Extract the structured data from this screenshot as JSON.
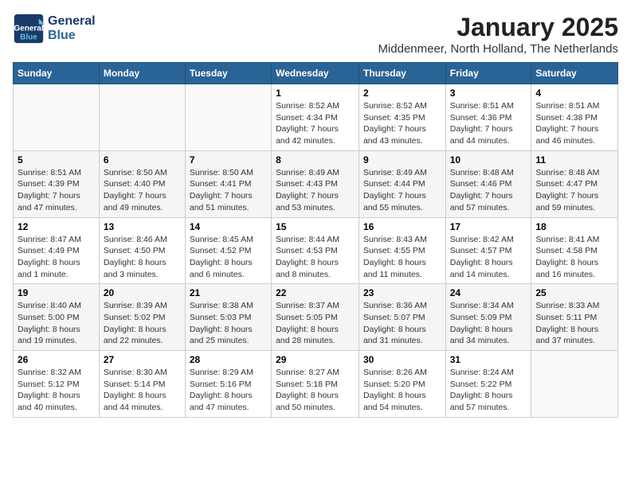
{
  "header": {
    "logo_line1": "General",
    "logo_line2": "Blue",
    "month_title": "January 2025",
    "subtitle": "Middenmeer, North Holland, The Netherlands"
  },
  "weekdays": [
    "Sunday",
    "Monday",
    "Tuesday",
    "Wednesday",
    "Thursday",
    "Friday",
    "Saturday"
  ],
  "weeks": [
    [
      {
        "day": "",
        "info": ""
      },
      {
        "day": "",
        "info": ""
      },
      {
        "day": "",
        "info": ""
      },
      {
        "day": "1",
        "info": "Sunrise: 8:52 AM\nSunset: 4:34 PM\nDaylight: 7 hours\nand 42 minutes."
      },
      {
        "day": "2",
        "info": "Sunrise: 8:52 AM\nSunset: 4:35 PM\nDaylight: 7 hours\nand 43 minutes."
      },
      {
        "day": "3",
        "info": "Sunrise: 8:51 AM\nSunset: 4:36 PM\nDaylight: 7 hours\nand 44 minutes."
      },
      {
        "day": "4",
        "info": "Sunrise: 8:51 AM\nSunset: 4:38 PM\nDaylight: 7 hours\nand 46 minutes."
      }
    ],
    [
      {
        "day": "5",
        "info": "Sunrise: 8:51 AM\nSunset: 4:39 PM\nDaylight: 7 hours\nand 47 minutes."
      },
      {
        "day": "6",
        "info": "Sunrise: 8:50 AM\nSunset: 4:40 PM\nDaylight: 7 hours\nand 49 minutes."
      },
      {
        "day": "7",
        "info": "Sunrise: 8:50 AM\nSunset: 4:41 PM\nDaylight: 7 hours\nand 51 minutes."
      },
      {
        "day": "8",
        "info": "Sunrise: 8:49 AM\nSunset: 4:43 PM\nDaylight: 7 hours\nand 53 minutes."
      },
      {
        "day": "9",
        "info": "Sunrise: 8:49 AM\nSunset: 4:44 PM\nDaylight: 7 hours\nand 55 minutes."
      },
      {
        "day": "10",
        "info": "Sunrise: 8:48 AM\nSunset: 4:46 PM\nDaylight: 7 hours\nand 57 minutes."
      },
      {
        "day": "11",
        "info": "Sunrise: 8:48 AM\nSunset: 4:47 PM\nDaylight: 7 hours\nand 59 minutes."
      }
    ],
    [
      {
        "day": "12",
        "info": "Sunrise: 8:47 AM\nSunset: 4:49 PM\nDaylight: 8 hours\nand 1 minute."
      },
      {
        "day": "13",
        "info": "Sunrise: 8:46 AM\nSunset: 4:50 PM\nDaylight: 8 hours\nand 3 minutes."
      },
      {
        "day": "14",
        "info": "Sunrise: 8:45 AM\nSunset: 4:52 PM\nDaylight: 8 hours\nand 6 minutes."
      },
      {
        "day": "15",
        "info": "Sunrise: 8:44 AM\nSunset: 4:53 PM\nDaylight: 8 hours\nand 8 minutes."
      },
      {
        "day": "16",
        "info": "Sunrise: 8:43 AM\nSunset: 4:55 PM\nDaylight: 8 hours\nand 11 minutes."
      },
      {
        "day": "17",
        "info": "Sunrise: 8:42 AM\nSunset: 4:57 PM\nDaylight: 8 hours\nand 14 minutes."
      },
      {
        "day": "18",
        "info": "Sunrise: 8:41 AM\nSunset: 4:58 PM\nDaylight: 8 hours\nand 16 minutes."
      }
    ],
    [
      {
        "day": "19",
        "info": "Sunrise: 8:40 AM\nSunset: 5:00 PM\nDaylight: 8 hours\nand 19 minutes."
      },
      {
        "day": "20",
        "info": "Sunrise: 8:39 AM\nSunset: 5:02 PM\nDaylight: 8 hours\nand 22 minutes."
      },
      {
        "day": "21",
        "info": "Sunrise: 8:38 AM\nSunset: 5:03 PM\nDaylight: 8 hours\nand 25 minutes."
      },
      {
        "day": "22",
        "info": "Sunrise: 8:37 AM\nSunset: 5:05 PM\nDaylight: 8 hours\nand 28 minutes."
      },
      {
        "day": "23",
        "info": "Sunrise: 8:36 AM\nSunset: 5:07 PM\nDaylight: 8 hours\nand 31 minutes."
      },
      {
        "day": "24",
        "info": "Sunrise: 8:34 AM\nSunset: 5:09 PM\nDaylight: 8 hours\nand 34 minutes."
      },
      {
        "day": "25",
        "info": "Sunrise: 8:33 AM\nSunset: 5:11 PM\nDaylight: 8 hours\nand 37 minutes."
      }
    ],
    [
      {
        "day": "26",
        "info": "Sunrise: 8:32 AM\nSunset: 5:12 PM\nDaylight: 8 hours\nand 40 minutes."
      },
      {
        "day": "27",
        "info": "Sunrise: 8:30 AM\nSunset: 5:14 PM\nDaylight: 8 hours\nand 44 minutes."
      },
      {
        "day": "28",
        "info": "Sunrise: 8:29 AM\nSunset: 5:16 PM\nDaylight: 8 hours\nand 47 minutes."
      },
      {
        "day": "29",
        "info": "Sunrise: 8:27 AM\nSunset: 5:18 PM\nDaylight: 8 hours\nand 50 minutes."
      },
      {
        "day": "30",
        "info": "Sunrise: 8:26 AM\nSunset: 5:20 PM\nDaylight: 8 hours\nand 54 minutes."
      },
      {
        "day": "31",
        "info": "Sunrise: 8:24 AM\nSunset: 5:22 PM\nDaylight: 8 hours\nand 57 minutes."
      },
      {
        "day": "",
        "info": ""
      }
    ]
  ]
}
